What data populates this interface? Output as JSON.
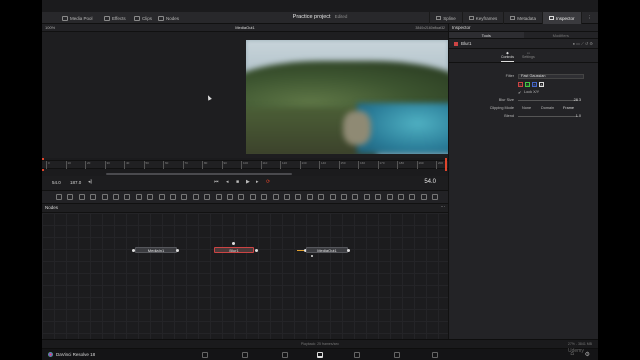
{
  "top": {
    "left_tabs": [
      {
        "label": "Media Pool",
        "icon": "media-pool-icon"
      },
      {
        "label": "Effects",
        "icon": "effects-icon"
      },
      {
        "label": "Clips",
        "icon": "clips-icon"
      },
      {
        "label": "Nodes",
        "icon": "nodes-icon"
      }
    ],
    "project": "Practice project",
    "project_state": "Edited",
    "right_tabs": [
      {
        "label": "Spline",
        "icon": "spline-icon"
      },
      {
        "label": "Keyframes",
        "icon": "keyframes-icon"
      },
      {
        "label": "Metadata",
        "icon": "metadata-icon"
      },
      {
        "label": "Inspector",
        "icon": "inspector-icon"
      }
    ]
  },
  "viewer": {
    "zoom": "100%",
    "title": "MediaOut1",
    "resolution": "3840x2160xfloat32"
  },
  "ruler": {
    "ticks": [
      "0",
      "10",
      "20",
      "30",
      "40",
      "50",
      "60",
      "70",
      "80",
      "90",
      "100",
      "110",
      "120",
      "130",
      "140",
      "150",
      "160",
      "170",
      "180",
      "190",
      "200"
    ]
  },
  "transport": {
    "start": "54.0",
    "end": "187.0",
    "current": "54.0"
  },
  "nodes": {
    "title": "Nodes",
    "items": [
      "MediaIn1",
      "Blur1",
      "MediaOut1"
    ]
  },
  "inspector": {
    "title": "Inspector",
    "tabs": [
      "Tools",
      "Modifiers"
    ],
    "tool_name": "Blur1",
    "subtabs": [
      "Controls",
      "Settings"
    ],
    "filter_label": "Filter",
    "filter_value": "Fast Gaussian",
    "channels": [
      "R",
      "G",
      "B",
      "A"
    ],
    "lock_label": "Lock X/Y",
    "blur_size_label": "Blur Size",
    "blur_size_value": "28.3",
    "clipping_label": "Clipping Mode",
    "clipping_options": [
      "None",
      "Domain",
      "Frame"
    ],
    "blend_label": "Blend",
    "blend_value": "1.0"
  },
  "status": {
    "playback": "Playback: 25 frames/sec",
    "memory": "27% - 3841 MB"
  },
  "app": {
    "name": "DaVinci Resolve 18"
  },
  "watermark": "Udemy"
}
